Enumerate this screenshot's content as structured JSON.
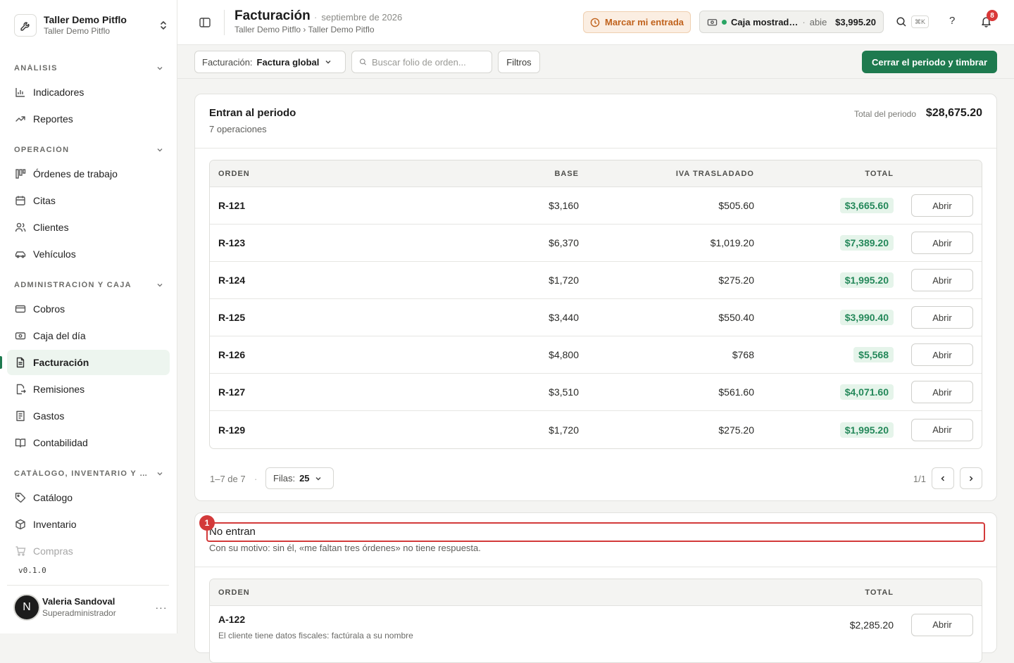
{
  "org": {
    "name": "Taller Demo Pitflo",
    "subtitle": "Taller Demo Pitflo"
  },
  "sidebar": {
    "sections": [
      {
        "label": "ANÁLISIS"
      },
      {
        "label": "OPERACIÓN"
      },
      {
        "label": "ADMINISTRACIÓN Y CAJA"
      },
      {
        "label": "CATÁLOGO, INVENTARIO Y CO…"
      }
    ],
    "items": [
      {
        "label": "Indicadores",
        "icon": "bar-chart-icon"
      },
      {
        "label": "Reportes",
        "icon": "trending-up-icon"
      },
      {
        "label": "Órdenes de trabajo",
        "icon": "kanban-icon"
      },
      {
        "label": "Citas",
        "icon": "calendar-icon"
      },
      {
        "label": "Clientes",
        "icon": "users-icon"
      },
      {
        "label": "Vehículos",
        "icon": "car-icon"
      },
      {
        "label": "Cobros",
        "icon": "credit-card-icon"
      },
      {
        "label": "Caja del día",
        "icon": "cash-register-icon"
      },
      {
        "label": "Facturación",
        "icon": "file-text-icon",
        "active": true
      },
      {
        "label": "Remisiones",
        "icon": "file-export-icon"
      },
      {
        "label": "Gastos",
        "icon": "receipt-icon"
      },
      {
        "label": "Contabilidad",
        "icon": "book-icon"
      },
      {
        "label": "Catálogo",
        "icon": "tag-icon"
      },
      {
        "label": "Inventario",
        "icon": "box-icon"
      },
      {
        "label": "Compras",
        "icon": "cart-icon"
      }
    ],
    "version": "v0.1.0",
    "user": {
      "initial": "N",
      "name": "Valeria Sandoval",
      "role": "Superadministrador",
      "more": "···"
    }
  },
  "header": {
    "title": "Facturación",
    "period": "septiembre de 2026",
    "breadcrumb": "Taller Demo Pitflo › Taller Demo Pitflo",
    "checkin_label": "Marcar mi entrada",
    "cash": {
      "name": "Caja mostrad…",
      "separator": "·",
      "status": "abie",
      "amount": "$3,995.20"
    },
    "shortcut": "⌘K",
    "help": "?",
    "notifications": "8"
  },
  "toolbar": {
    "billing_key": "Facturación:",
    "billing_value": "Factura global",
    "search_placeholder": "Buscar folio de orden...",
    "filters_label": "Filtros",
    "close_period_label": "Cerrar el periodo y timbrar"
  },
  "included": {
    "title": "Entran al periodo",
    "subtitle": "7 operaciones",
    "total_label": "Total del periodo",
    "total_value": "$28,675.20",
    "columns": {
      "order": "ORDEN",
      "base": "BASE",
      "iva": "IVA TRASLADADO",
      "total": "TOTAL"
    },
    "rows": [
      {
        "order": "R-121",
        "base": "$3,160",
        "iva": "$505.60",
        "total": "$3,665.60",
        "action": "Abrir"
      },
      {
        "order": "R-123",
        "base": "$6,370",
        "iva": "$1,019.20",
        "total": "$7,389.20",
        "action": "Abrir"
      },
      {
        "order": "R-124",
        "base": "$1,720",
        "iva": "$275.20",
        "total": "$1,995.20",
        "action": "Abrir"
      },
      {
        "order": "R-125",
        "base": "$3,440",
        "iva": "$550.40",
        "total": "$3,990.40",
        "action": "Abrir"
      },
      {
        "order": "R-126",
        "base": "$4,800",
        "iva": "$768",
        "total": "$5,568",
        "action": "Abrir"
      },
      {
        "order": "R-127",
        "base": "$3,510",
        "iva": "$561.60",
        "total": "$4,071.60",
        "action": "Abrir"
      },
      {
        "order": "R-129",
        "base": "$1,720",
        "iva": "$275.20",
        "total": "$1,995.20",
        "action": "Abrir"
      }
    ],
    "pager": {
      "range": "1–7 de 7",
      "dot": "·",
      "rows_key": "Filas:",
      "rows_value": "25",
      "page": "1/1"
    }
  },
  "excluded": {
    "badge": "1",
    "title": "No entran",
    "subtitle": "Con su motivo: sin él, «me faltan tres órdenes» no tiene respuesta.",
    "columns": {
      "order": "ORDEN",
      "total": "TOTAL"
    },
    "rows": [
      {
        "order": "A-122",
        "reason": "El cliente tiene datos fiscales: factúrala a su nombre",
        "total": "$2,285.20",
        "action": "Abrir"
      }
    ]
  },
  "colors": {
    "accent": "#1e7a4f",
    "positive_bg": "#e5f4ea",
    "positive_text": "#24885a",
    "warning_bg": "#fbeee2",
    "danger": "#d33a3a"
  }
}
